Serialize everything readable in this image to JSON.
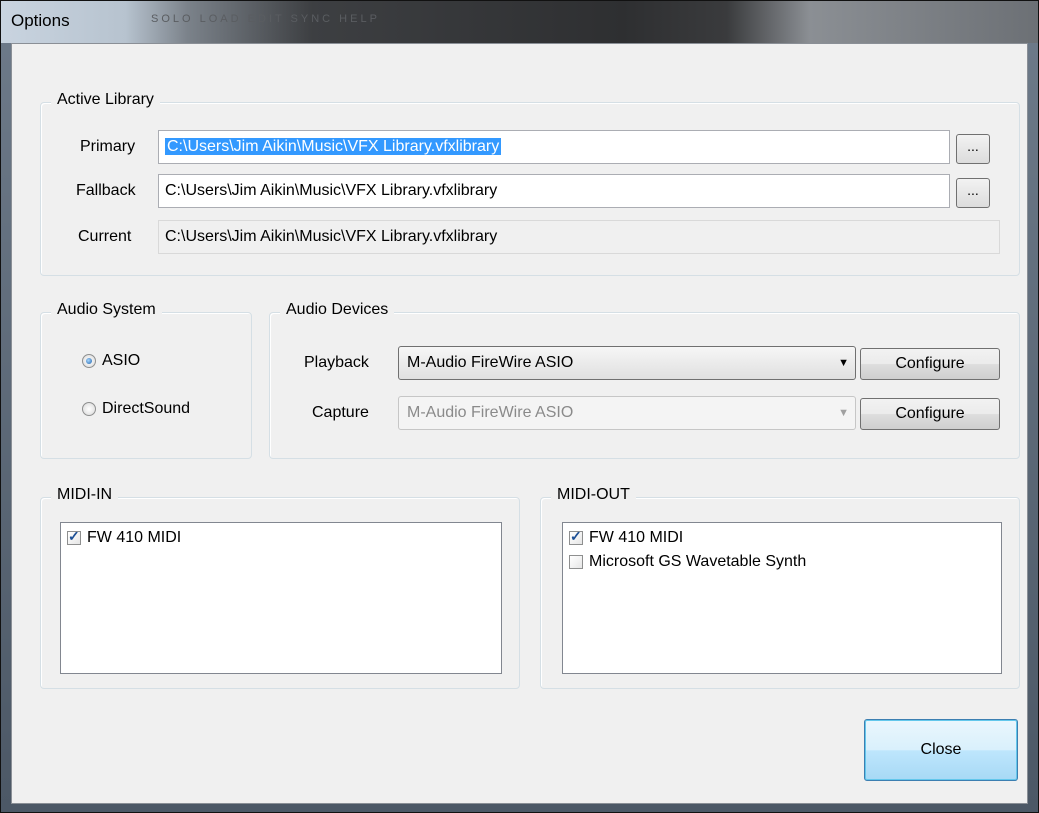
{
  "window": {
    "title": "Options",
    "background_menu_text": "SOLO  LOAD  EDIT  SYNC  HELP"
  },
  "active_library": {
    "group_label": "Active Library",
    "primary_label": "Primary",
    "primary_value": "C:\\Users\\Jim Aikin\\Music\\VFX Library.vfxlibrary",
    "fallback_label": "Fallback",
    "fallback_value": "C:\\Users\\Jim Aikin\\Music\\VFX Library.vfxlibrary",
    "current_label": "Current",
    "current_value": "C:\\Users\\Jim Aikin\\Music\\VFX Library.vfxlibrary",
    "browse_label": "..."
  },
  "audio_system": {
    "group_label": "Audio System",
    "options": [
      {
        "label": "ASIO",
        "selected": true
      },
      {
        "label": "DirectSound",
        "selected": false
      }
    ]
  },
  "audio_devices": {
    "group_label": "Audio Devices",
    "playback_label": "Playback",
    "playback_value": "M-Audio FireWire ASIO",
    "capture_label": "Capture",
    "capture_value": "M-Audio FireWire ASIO",
    "configure_label": "Configure"
  },
  "midi_in": {
    "group_label": "MIDI-IN",
    "items": [
      {
        "label": "FW 410 MIDI",
        "checked": true
      }
    ]
  },
  "midi_out": {
    "group_label": "MIDI-OUT",
    "items": [
      {
        "label": "FW 410 MIDI",
        "checked": true
      },
      {
        "label": "Microsoft GS Wavetable Synth",
        "checked": false
      }
    ]
  },
  "footer": {
    "close_label": "Close"
  },
  "colors": {
    "selection": "#3399ff",
    "dialog_bg": "#f0f0f0",
    "default_button": "#bee6fd"
  }
}
